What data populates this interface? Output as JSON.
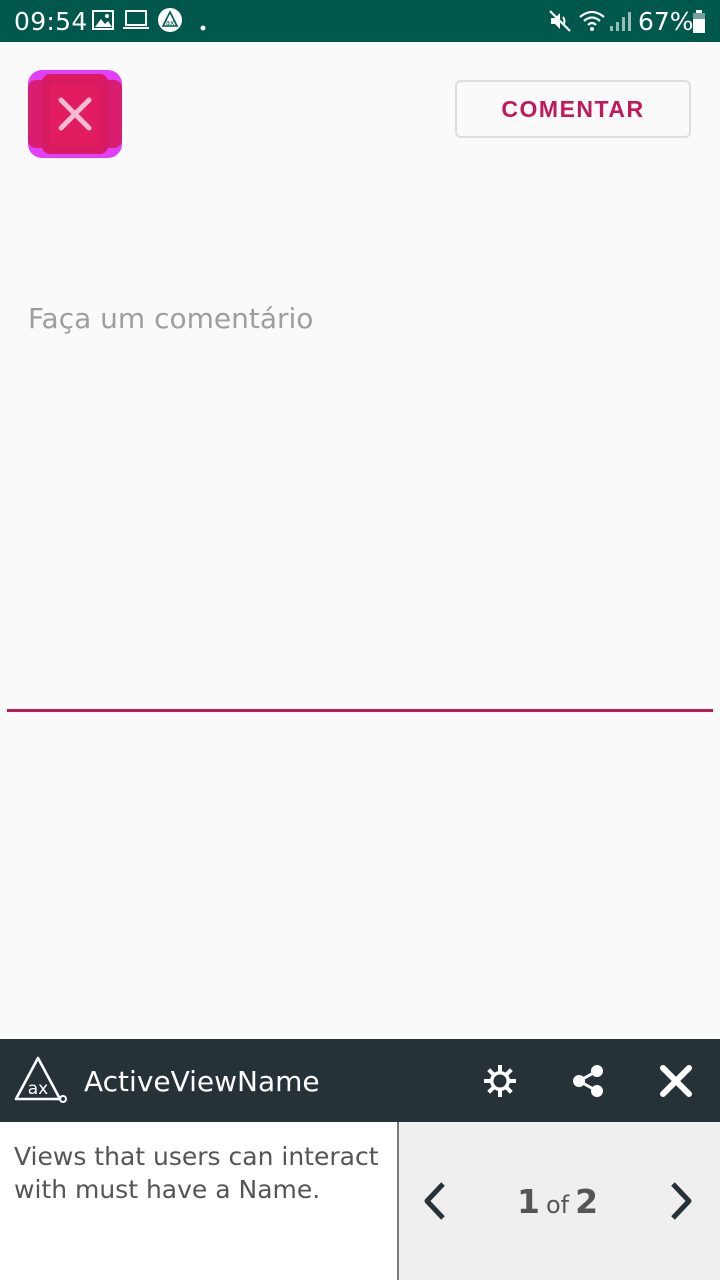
{
  "status_bar": {
    "time": "09:54",
    "battery": "67%",
    "icons": [
      "image-icon",
      "laptop-icon",
      "accessibility-scanner-icon",
      "dot-icon",
      "mute-icon",
      "wifi-icon",
      "signal-icon",
      "battery-icon"
    ]
  },
  "app": {
    "close_icon": "close-icon",
    "comment_button_label": "COMENTAR",
    "comment_placeholder": "Faça um comentário",
    "comment_value": "",
    "accent_color": "#c2185b"
  },
  "scanner": {
    "title": "ActiveViewName",
    "description": "Views that users can interact with must have a Name.",
    "pager": {
      "current": "1",
      "of": "of",
      "total": "2"
    },
    "icons": [
      "ax-logo-icon",
      "settings-icon",
      "share-icon",
      "close-icon",
      "chevron-left-icon",
      "chevron-right-icon"
    ]
  }
}
